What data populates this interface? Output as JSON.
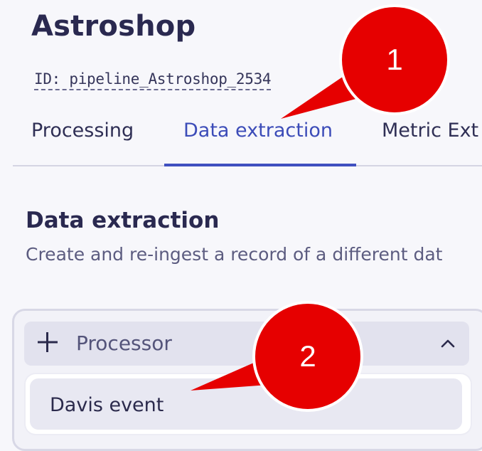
{
  "header": {
    "title": "Astroshop",
    "pipeline_id": "ID: pipeline_Astroshop_2534"
  },
  "tabs": [
    {
      "label": "Processing",
      "active": false
    },
    {
      "label": "Data extraction",
      "active": true
    },
    {
      "label": "Metric Ext",
      "active": false
    }
  ],
  "section": {
    "title": "Data extraction",
    "description": "Create and re-ingest a record of a different dat"
  },
  "processor": {
    "plus_icon": "plus-icon",
    "label": "Processor",
    "chevron_icon": "chevron-up-icon",
    "menu_items": [
      {
        "label": "Davis event"
      }
    ]
  },
  "annotations": [
    {
      "number": "1"
    },
    {
      "number": "2"
    }
  ],
  "colors": {
    "accent": "#4050c0",
    "annotation_red": "#e60000"
  }
}
